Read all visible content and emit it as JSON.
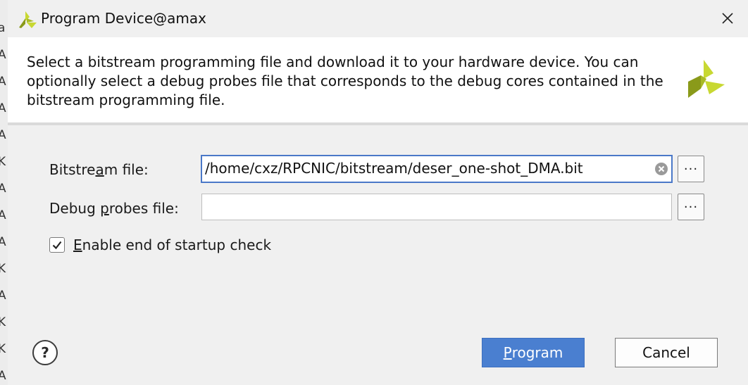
{
  "dialog": {
    "title": "Program Device@amax",
    "description": "Select a bitstream programming file and download it to your hardware device. You can optionally select a debug probes file that corresponds to the debug cores contained in the bitstream programming file."
  },
  "form": {
    "bitstream": {
      "label_pre": "Bitstream file: ",
      "label": "Bitstream file:",
      "value": "/home/cxz/RPCNIC/bitstream/deser_one-shot_DMA.bit",
      "browse_label": "···"
    },
    "debug_probes": {
      "label": "Debug probes file:",
      "value": "",
      "browse_label": "···"
    },
    "startup_check": {
      "label": "Enable end of startup check",
      "checked": true
    }
  },
  "buttons": {
    "help": "?",
    "program": "Program",
    "cancel": "Cancel"
  },
  "background_strip": [
    "a",
    "A",
    "A",
    "A",
    "A",
    "K",
    "A",
    "A",
    "A",
    "K",
    "A",
    "K",
    "K",
    "A"
  ],
  "colors": {
    "accent": "#4a7fd0",
    "logo_light": "#c8d832",
    "logo_dark": "#8a9a1a"
  },
  "icons": [
    "xilinx-logo-icon",
    "close-icon",
    "clear-icon",
    "ellipsis-icon",
    "check-icon",
    "help-icon"
  ]
}
